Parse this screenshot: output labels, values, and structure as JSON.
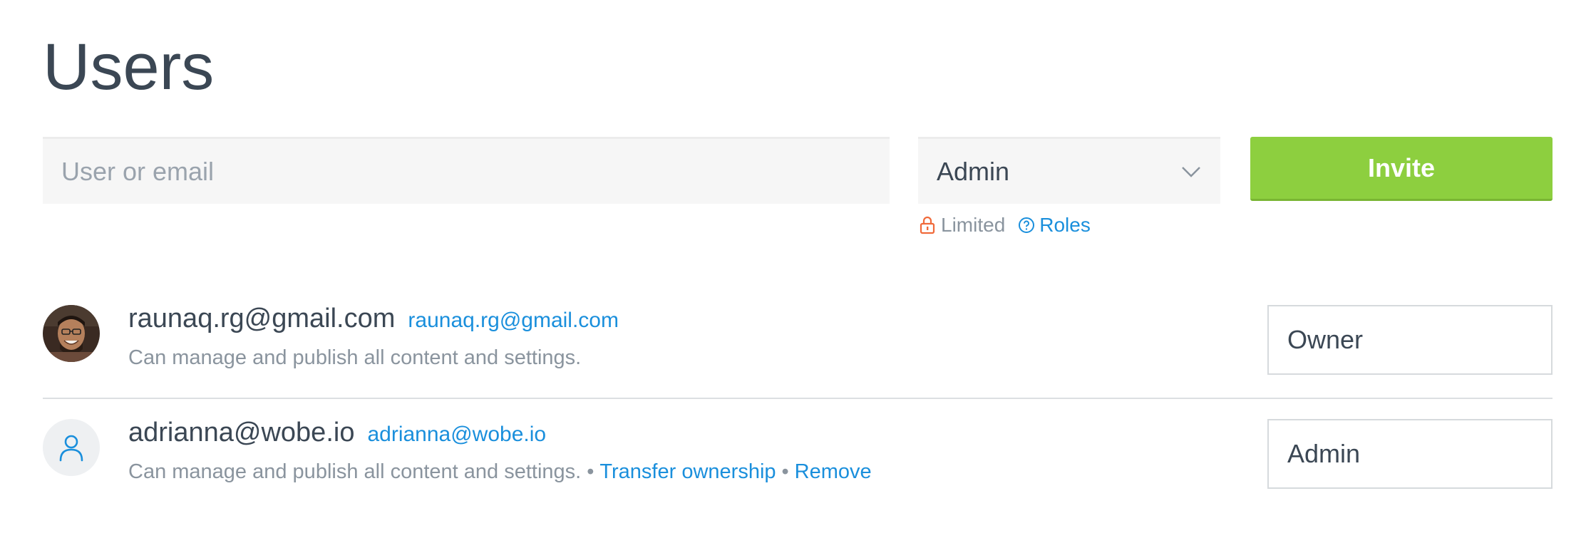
{
  "page": {
    "title": "Users"
  },
  "invite_form": {
    "search_placeholder": "User or email",
    "role_selected": "Admin",
    "invite_label": "Invite",
    "limited_label": "Limited",
    "roles_link_label": "Roles"
  },
  "users": [
    {
      "name": "raunaq.rg@gmail.com",
      "email": "raunaq.rg@gmail.com",
      "description": "Can manage and publish all content and settings.",
      "role": "Owner",
      "avatar": "photo"
    },
    {
      "name": "adrianna@wobe.io",
      "email": "adrianna@wobe.io",
      "description": "Can manage and publish all content and settings.",
      "separator": "•",
      "transfer_label": "Transfer ownership",
      "remove_label": "Remove",
      "role": "Admin",
      "avatar": "person-icon"
    }
  ],
  "colors": {
    "accent": "#1a8fdc",
    "invite_green": "#8dcf3f",
    "lock_orange": "#f06a3a",
    "title_text": "#3b4754",
    "muted_text": "#8a949e"
  }
}
